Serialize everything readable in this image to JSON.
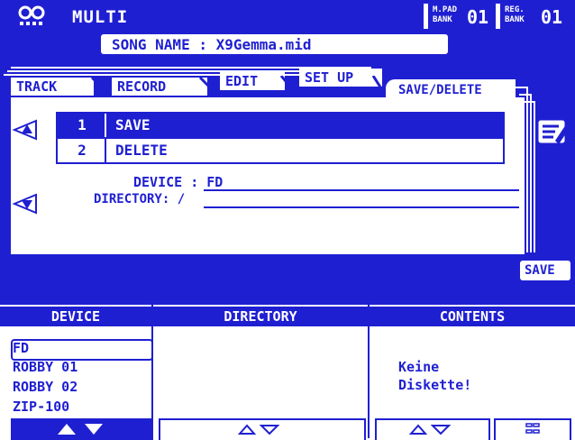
{
  "header": {
    "mode": "MULTI",
    "mode_icon": "multi-speaker-icon",
    "mpad_label_top": "M.PAD",
    "mpad_label_bottom": "BANK",
    "mpad_value": "01",
    "reg_label_top": "REG.",
    "reg_label_bottom": "BANK",
    "reg_value": "01",
    "song_name": "SONG NAME : X9Gemma.mid"
  },
  "tabs": [
    {
      "label": "TRACK"
    },
    {
      "label": "RECORD"
    },
    {
      "label": "EDIT"
    },
    {
      "label": "SET UP"
    }
  ],
  "active_tab": "SAVE/DELETE",
  "menu": [
    {
      "num": "1",
      "label": "SAVE",
      "selected": true
    },
    {
      "num": "2",
      "label": "DELETE",
      "selected": false
    }
  ],
  "device_text": "DEVICE : FD",
  "directory_text": "DIRECTORY: /",
  "save_button": "SAVE",
  "browser": {
    "headers": [
      "DEVICE",
      "DIRECTORY",
      "CONTENTS"
    ],
    "devices": [
      "FD",
      "ROBBY 01",
      "ROBBY 02",
      "ZIP-100"
    ],
    "selected_device": "FD",
    "contents_line1": "Keine",
    "contents_line2": "Diskette!"
  },
  "colors": {
    "accent": "#1f1fd2",
    "background": "#ffffff"
  }
}
